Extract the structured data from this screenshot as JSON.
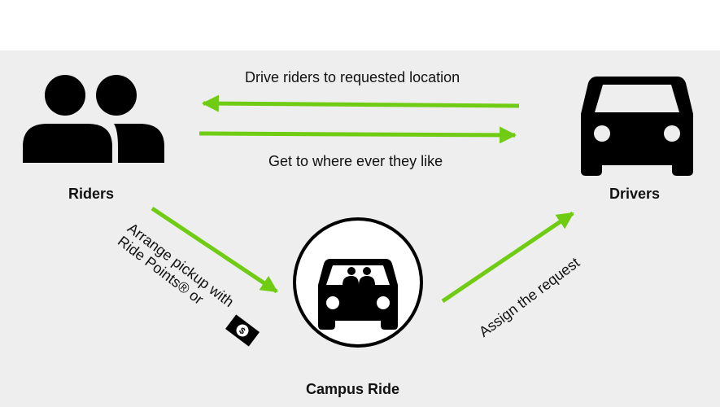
{
  "nodes": {
    "riders": {
      "label": "Riders",
      "icon": "group-people-icon"
    },
    "drivers": {
      "label": "Drivers",
      "icon": "car-icon"
    },
    "campus_ride": {
      "label": "Campus Ride",
      "icon": "car-with-passengers-icon"
    }
  },
  "edges": {
    "drivers_to_riders": "Drive riders to requested location",
    "riders_to_drivers": "Get to where ever they like",
    "riders_to_campus_line1": "Arrange pickup with",
    "riders_to_campus_line2": "Ride Points® or",
    "riders_to_campus_icon": "dollar-bill-icon",
    "campus_to_drivers": "Assign the request"
  },
  "colors": {
    "background": "#eeeeee",
    "arrow": "#6fcc13",
    "icon": "#000000"
  }
}
